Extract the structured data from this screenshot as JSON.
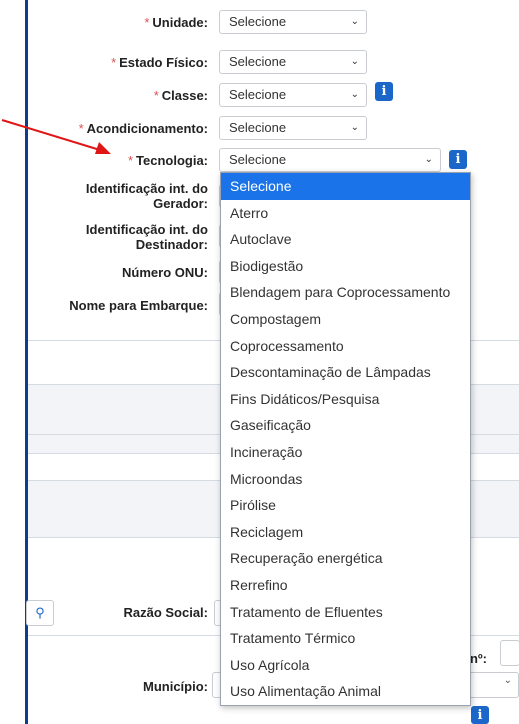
{
  "form": {
    "unidade": {
      "label": "Unidade:",
      "required": "*",
      "value": "Selecione"
    },
    "estado_fisico": {
      "label": "Estado Físico:",
      "required": "*",
      "value": "Selecione"
    },
    "classe": {
      "label": "Classe:",
      "required": "*",
      "value": "Selecione"
    },
    "acondicionamento": {
      "label": "Acondicionamento:",
      "required": "*",
      "value": "Selecione"
    },
    "tecnologia": {
      "label": "Tecnologia:",
      "required": "*",
      "value": "Selecione"
    },
    "id_gerador": {
      "label": "Identificação int. do Gerador:"
    },
    "id_destinador": {
      "label": "Identificação int. do Destinador:"
    },
    "numero_onu": {
      "label": "Número ONU:"
    },
    "nome_embarque": {
      "label": "Nome para Embarque:"
    }
  },
  "lower": {
    "razao_social_label": "Razão Social:",
    "numero_label": "nº:",
    "municipio_label": "Município:"
  },
  "tecnologia_options": [
    "Selecione",
    "Aterro",
    "Autoclave",
    "Biodigestão",
    "Blendagem para Coprocessamento",
    "Compostagem",
    "Coprocessamento",
    "Descontaminação de Lâmpadas",
    "Fins Didáticos/Pesquisa",
    "Gaseificação",
    "Incineração",
    "Microondas",
    "Pirólise",
    "Reciclagem",
    "Recuperação energética",
    "Rerrefino",
    "Tratamento de Efluentes",
    "Tratamento Térmico",
    "Uso Agrícola",
    "Uso Alimentação Animal"
  ],
  "selected_option_index": 0,
  "colors": {
    "accent": "#1a73e8",
    "required": "#d9534f",
    "info_icon": "#1b66c9",
    "annotation_arrow": "#e01515",
    "left_rule": "#0b3d91"
  },
  "icons": {
    "chevron": "chevron-down-icon",
    "info": "info-icon",
    "search": "search-icon"
  }
}
